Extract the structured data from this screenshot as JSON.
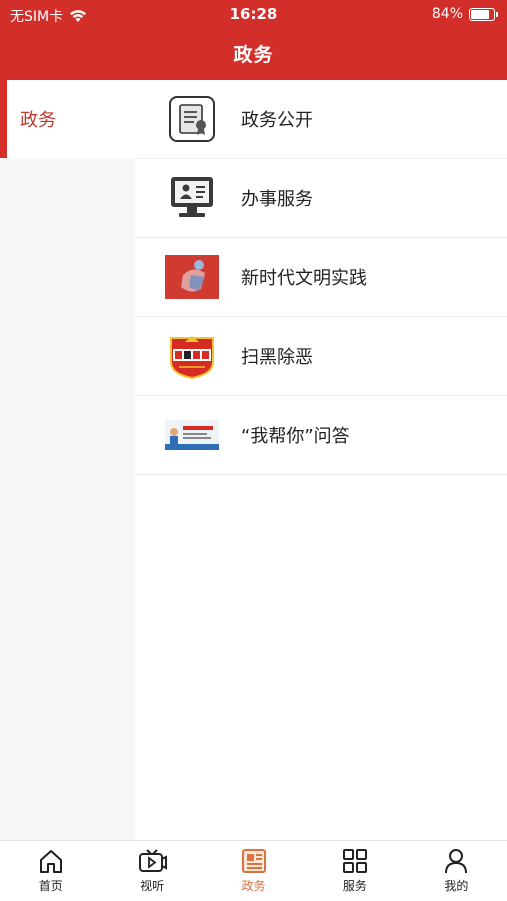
{
  "status": {
    "carrier": "无SIM卡",
    "time": "16:28",
    "battery_percent": "84%",
    "battery_level": 0.84
  },
  "header": {
    "title": "政务"
  },
  "sidebar": {
    "items": [
      {
        "label": "政务",
        "active": true
      }
    ]
  },
  "list": {
    "items": [
      {
        "label": "政务公开",
        "icon": "document-seal-icon"
      },
      {
        "label": "办事服务",
        "icon": "computer-user-icon"
      },
      {
        "label": "新时代文明实践",
        "icon": "civilization-practice-image"
      },
      {
        "label": "扫黑除恶",
        "icon": "saohei-chue-badge"
      },
      {
        "label": "“我帮你”问答",
        "icon": "woba-ni-banner"
      }
    ]
  },
  "tabbar": {
    "tabs": [
      {
        "label": "首页",
        "icon": "home-icon"
      },
      {
        "label": "视听",
        "icon": "tv-play-icon"
      },
      {
        "label": "政务",
        "icon": "newspaper-icon",
        "active": true
      },
      {
        "label": "服务",
        "icon": "grid-icon"
      },
      {
        "label": "我的",
        "icon": "person-icon"
      }
    ]
  },
  "colors": {
    "brand_red": "#d32f2a",
    "active_tab": "#d9733f",
    "sidebar_active_text": "#c0392b"
  }
}
